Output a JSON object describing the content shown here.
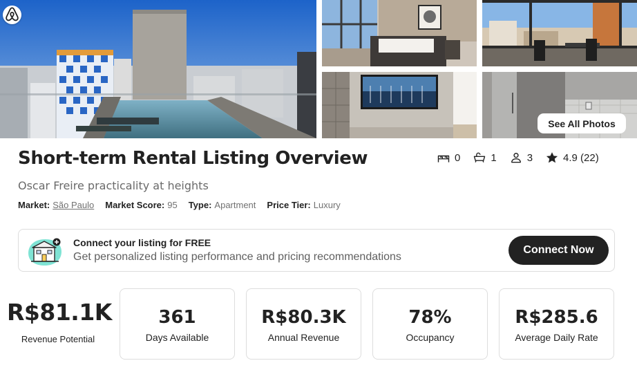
{
  "gallery": {
    "brand_icon": "airbnb-logo-icon",
    "photos": [
      {
        "name": "rooftop-pool-photo"
      },
      {
        "name": "bedroom-photo"
      },
      {
        "name": "balcony-photo"
      },
      {
        "name": "living-room-photo"
      },
      {
        "name": "kitchen-photo"
      }
    ],
    "see_all_label": "See All Photos"
  },
  "listing": {
    "title": "Short-term Rental Listing Overview",
    "subtitle": "Oscar Freire practicality at heights",
    "facts": [
      {
        "label": "Market:",
        "value": "São Paulo"
      },
      {
        "label": "Market Score:",
        "value": "95"
      },
      {
        "label": "Type:",
        "value": "Apartment"
      },
      {
        "label": "Price Tier:",
        "value": "Luxury"
      }
    ],
    "amenities": [
      {
        "icon": "bed-icon",
        "value": "0"
      },
      {
        "icon": "bathtub-icon",
        "value": "1"
      },
      {
        "icon": "guest-icon",
        "value": "3"
      },
      {
        "icon": "star-icon",
        "value": "4.9 (22)"
      }
    ]
  },
  "banner": {
    "icon": "house-illustration-icon",
    "title": "Connect your listing for FREE",
    "description": "Get personalized listing performance and pricing recommendations",
    "button_label": "Connect Now"
  },
  "metrics": {
    "revenue_potential": {
      "value": "R$81.1K",
      "label": "Revenue Potential"
    },
    "cards": [
      {
        "value": "361",
        "label": "Days Available"
      },
      {
        "value": "R$80.3K",
        "label": "Annual Revenue"
      },
      {
        "value": "78%",
        "label": "Occupancy"
      },
      {
        "value": "R$285.6",
        "label": "Average Daily Rate"
      }
    ]
  },
  "colors": {
    "text_primary": "#222222",
    "text_secondary": "#717171",
    "button_dark": "#222222",
    "airbnb_brand": "#FF385C"
  }
}
